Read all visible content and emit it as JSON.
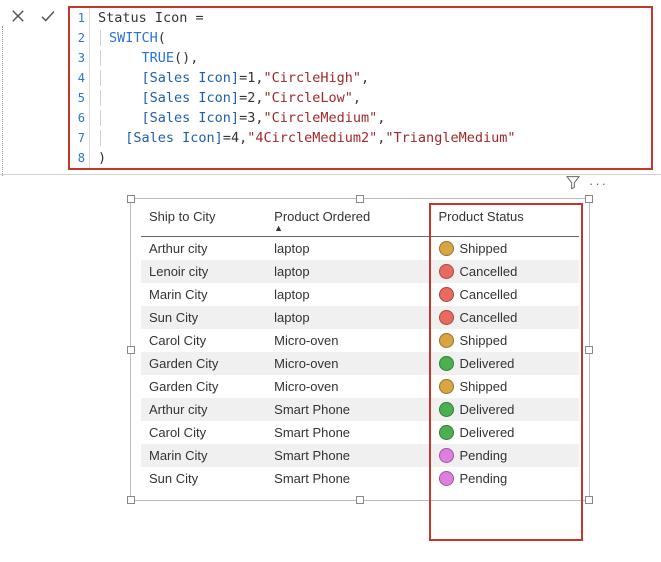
{
  "formula": {
    "measure_name": "Status Icon",
    "fn": "SWITCH",
    "true_fn": "TRUE",
    "col": "[Sales Icon]",
    "cases": [
      {
        "val": "1",
        "result": "\"CircleHigh\""
      },
      {
        "val": "2",
        "result": "\"CircleLow\""
      },
      {
        "val": "3",
        "result": "\"CircleMedium\""
      }
    ],
    "last_val": "4",
    "last_result": "\"4CircleMedium2\"",
    "default_result": "\"TriangleMedium\"",
    "line_numbers": [
      "1",
      "2",
      "3",
      "4",
      "5",
      "6",
      "7",
      "8"
    ]
  },
  "table": {
    "headers": {
      "c1": "Ship to City",
      "c2": "Product Ordered",
      "c3": "Product Status"
    },
    "rows": [
      {
        "city": "Arthur city",
        "product": "laptop",
        "status": "Shipped",
        "color": "#d9a441"
      },
      {
        "city": "Lenoir city",
        "product": "laptop",
        "status": "Cancelled",
        "color": "#e96a5f"
      },
      {
        "city": "Marin City",
        "product": "laptop",
        "status": "Cancelled",
        "color": "#e96a5f"
      },
      {
        "city": "Sun City",
        "product": "laptop",
        "status": "Cancelled",
        "color": "#e96a5f"
      },
      {
        "city": "Carol City",
        "product": "Micro-oven",
        "status": "Shipped",
        "color": "#d9a441"
      },
      {
        "city": "Garden City",
        "product": "Micro-oven",
        "status": "Delivered",
        "color": "#4caf50"
      },
      {
        "city": "Garden City",
        "product": "Micro-oven",
        "status": "Shipped",
        "color": "#d9a441"
      },
      {
        "city": "Arthur city",
        "product": "Smart Phone",
        "status": "Delivered",
        "color": "#4caf50"
      },
      {
        "city": "Carol City",
        "product": "Smart Phone",
        "status": "Delivered",
        "color": "#4caf50"
      },
      {
        "city": "Marin City",
        "product": "Smart Phone",
        "status": "Pending",
        "color": "#e07de0"
      },
      {
        "city": "Sun City",
        "product": "Smart Phone",
        "status": "Pending",
        "color": "#e07de0"
      }
    ]
  }
}
